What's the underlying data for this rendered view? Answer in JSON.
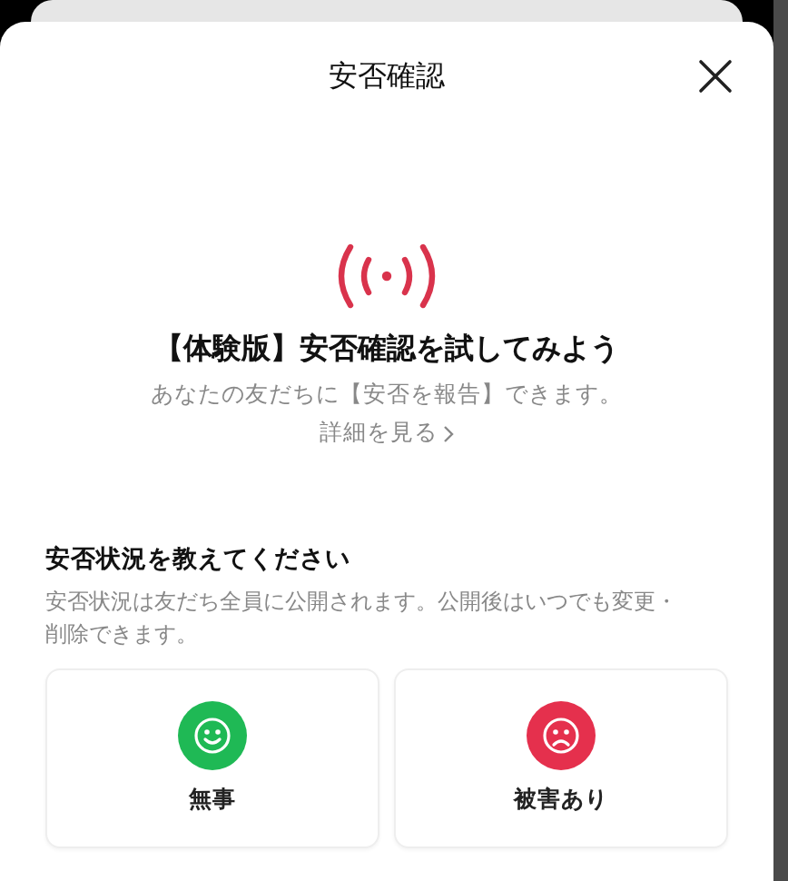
{
  "sheet": {
    "title": "安否確認"
  },
  "intro": {
    "heading": "【体験版】安否確認を試してみよう",
    "subtitle": "あなたの友だちに【安否を報告】できます。",
    "link": "詳細を見る"
  },
  "status": {
    "title": "安否状況を教えてください",
    "description": "安否状況は友だち全員に公開されます。公開後はいつでも変更・削除できます。"
  },
  "options": [
    {
      "kind": "smile",
      "label": "無事",
      "color": "#1fb955"
    },
    {
      "kind": "frown",
      "label": "被害あり",
      "color": "#e5304d"
    }
  ]
}
